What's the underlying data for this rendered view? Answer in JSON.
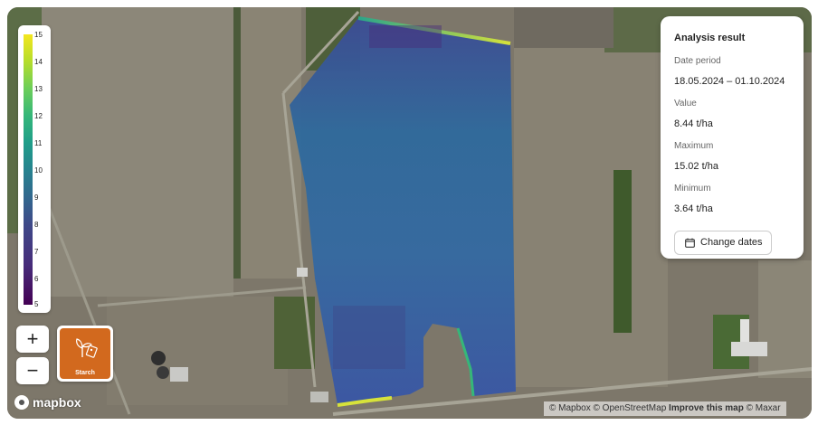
{
  "legend": {
    "ticks": [
      "15",
      "14",
      "13",
      "12",
      "11",
      "10",
      "9",
      "8",
      "7",
      "6",
      "5"
    ],
    "colors": [
      "#440154",
      "#3e4a89",
      "#26838f",
      "#35b779",
      "#b5dd2b",
      "#f4e61e"
    ]
  },
  "map_controls": {
    "zoom_in": "+",
    "zoom_out": "−",
    "layer_label": "Starch",
    "layer_color": "#d2691e"
  },
  "panel": {
    "title": "Analysis result",
    "date_period_label": "Date period",
    "date_period_value": "18.05.2024 – 01.10.2024",
    "value_label": "Value",
    "value_value": "8.44 t/ha",
    "maximum_label": "Maximum",
    "maximum_value": "15.02 t/ha",
    "minimum_label": "Minimum",
    "minimum_value": "3.64 t/ha",
    "change_dates_label": "Change dates",
    "change_dates_icon": "calendar-icon"
  },
  "branding": {
    "logo_text": "mapbox"
  },
  "attribution": {
    "mapbox": "© Mapbox",
    "osm": "© OpenStreetMap",
    "improve": "Improve this map",
    "maxar": "© Maxar"
  }
}
